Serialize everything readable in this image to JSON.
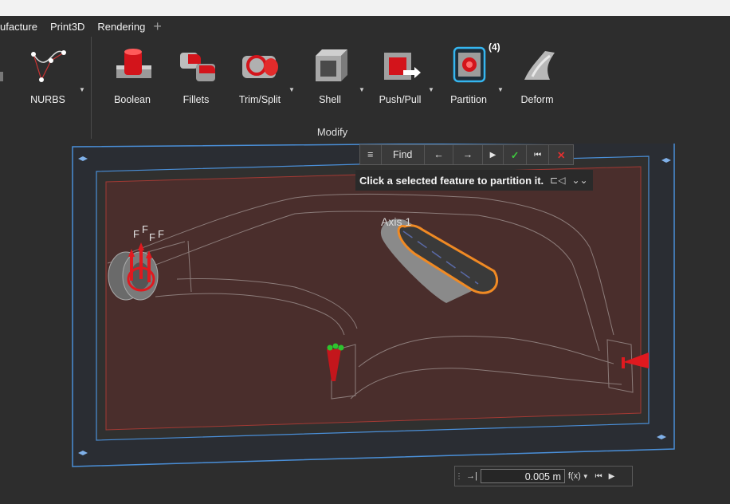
{
  "menu": {
    "items": [
      "ufacture",
      "Print3D",
      "Rendering"
    ],
    "add_tab_icon": "plus-icon"
  },
  "ribbon": {
    "nurbs_label": "NURBS",
    "tools": [
      {
        "label": "Boolean",
        "icon": "boolean-icon"
      },
      {
        "label": "Fillets",
        "icon": "fillets-icon"
      },
      {
        "label": "Trim/Split",
        "icon": "trim-split-icon"
      },
      {
        "label": "Shell",
        "icon": "shell-icon"
      },
      {
        "label": "Push/Pull",
        "icon": "push-pull-icon"
      },
      {
        "label": "Partition",
        "icon": "partition-icon"
      },
      {
        "label": "Deform",
        "icon": "deform-icon"
      }
    ],
    "group_label": "Modify",
    "partition_badge": "(4)"
  },
  "findbar": {
    "menu_icon": "≡",
    "find_label": "Find",
    "prev_icon": "←",
    "next_icon": "→",
    "play_icon": "▶",
    "ok_icon": "✓",
    "first_icon": "⏮",
    "cancel_icon": "✕"
  },
  "hint": {
    "text": "Click a selected feature to partition it.",
    "camera_icon": "⊏◁",
    "expand_icon": "⌄⌄"
  },
  "viewport": {
    "axis_label": "Axis 1",
    "force_label": "F",
    "colors": {
      "boundary": "#4a8fd8",
      "plane": "#4a2e2c",
      "highlight": "#f08a24",
      "force": "#e0191f",
      "grip": "#2ec32e"
    }
  },
  "value_input": {
    "value": "0.005 m",
    "fx_label": "f(x)",
    "first_icon": "⏮",
    "play_icon": "▶"
  }
}
